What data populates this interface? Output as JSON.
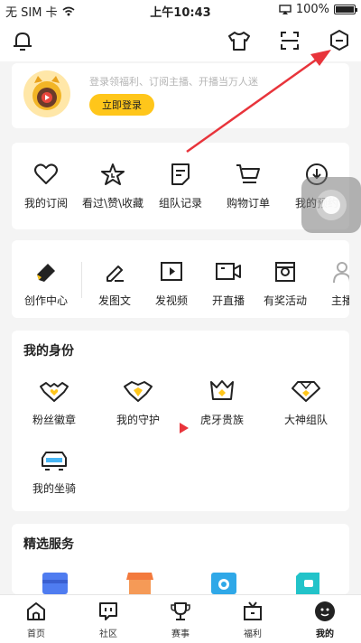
{
  "status_bar": {
    "carrier": "无 SIM 卡",
    "time": "上午10:43",
    "battery": "100%"
  },
  "top_bar": {
    "icons": [
      "bell-icon",
      "tshirt-icon",
      "scan-icon",
      "hexagon-minus-icon"
    ]
  },
  "login": {
    "hint": "登录领福利、订阅主播、开播当万人迷",
    "button": "立即登录"
  },
  "row1": [
    {
      "label": "我的订阅",
      "icon": "heart-icon"
    },
    {
      "label": "看过\\赞\\收藏",
      "icon": "star-icon"
    },
    {
      "label": "组队记录",
      "icon": "note-icon"
    },
    {
      "label": "购物订单",
      "icon": "cart-icon"
    },
    {
      "label": "我的预约",
      "icon": "download-icon"
    }
  ],
  "row2": [
    {
      "label": "创作中心",
      "icon": "pen-icon"
    },
    {
      "label": "发图文",
      "icon": "edit-icon"
    },
    {
      "label": "发视频",
      "icon": "play-icon"
    },
    {
      "label": "开直播",
      "icon": "camera-icon"
    },
    {
      "label": "有奖活动",
      "icon": "gift-icon"
    },
    {
      "label": "主播",
      "icon": "person-icon"
    }
  ],
  "identity": {
    "title": "我的身份",
    "items": [
      {
        "label": "粉丝徽章",
        "icon": "heart-badge-icon"
      },
      {
        "label": "我的守护",
        "icon": "shield-icon"
      },
      {
        "label": "虎牙贵族",
        "icon": "crown-icon"
      },
      {
        "label": "大神组队",
        "icon": "diamond-icon"
      },
      {
        "label": "我的坐骑",
        "icon": "car-icon"
      }
    ]
  },
  "services": {
    "title": "精选服务"
  },
  "tabs": [
    {
      "label": "首页",
      "icon": "home-icon"
    },
    {
      "label": "社区",
      "icon": "community-icon"
    },
    {
      "label": "赛事",
      "icon": "trophy-icon"
    },
    {
      "label": "福利",
      "icon": "tv-icon"
    },
    {
      "label": "我的",
      "icon": "profile-icon",
      "active": true
    }
  ],
  "colors": {
    "accent": "#ffc61a",
    "arrow": "#e8343b"
  }
}
